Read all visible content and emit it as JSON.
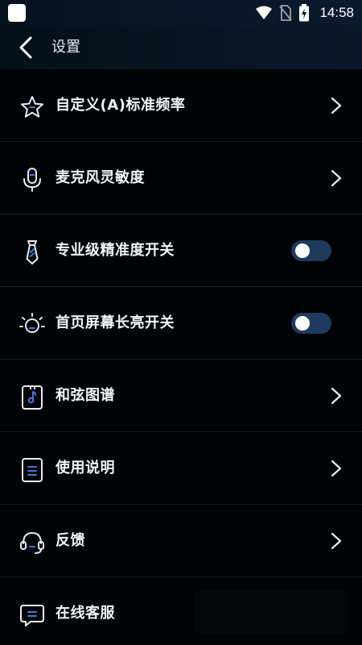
{
  "status_bar": {
    "time": "14:58"
  },
  "header": {
    "title": "设置"
  },
  "settings": [
    {
      "label": "自定义(A)标准频率",
      "type": "link",
      "icon": "star-icon"
    },
    {
      "label": "麦克风灵敏度",
      "type": "link",
      "icon": "microphone-icon"
    },
    {
      "label": "专业级精准度开关",
      "type": "toggle",
      "icon": "tie-icon",
      "on": false
    },
    {
      "label": "首页屏幕长亮开关",
      "type": "toggle",
      "icon": "sun-icon",
      "on": false
    },
    {
      "label": "和弦图谱",
      "type": "link",
      "icon": "music-book-icon"
    },
    {
      "label": "使用说明",
      "type": "link",
      "icon": "document-icon"
    },
    {
      "label": "反馈",
      "type": "link",
      "icon": "headset-icon"
    },
    {
      "label": "在线客服",
      "type": "none",
      "icon": "chat-icon"
    }
  ],
  "colors": {
    "background": "#000305",
    "accent": "#3f7bd6",
    "toggle_track": "#1f3a5c",
    "divider": "#141c26"
  }
}
